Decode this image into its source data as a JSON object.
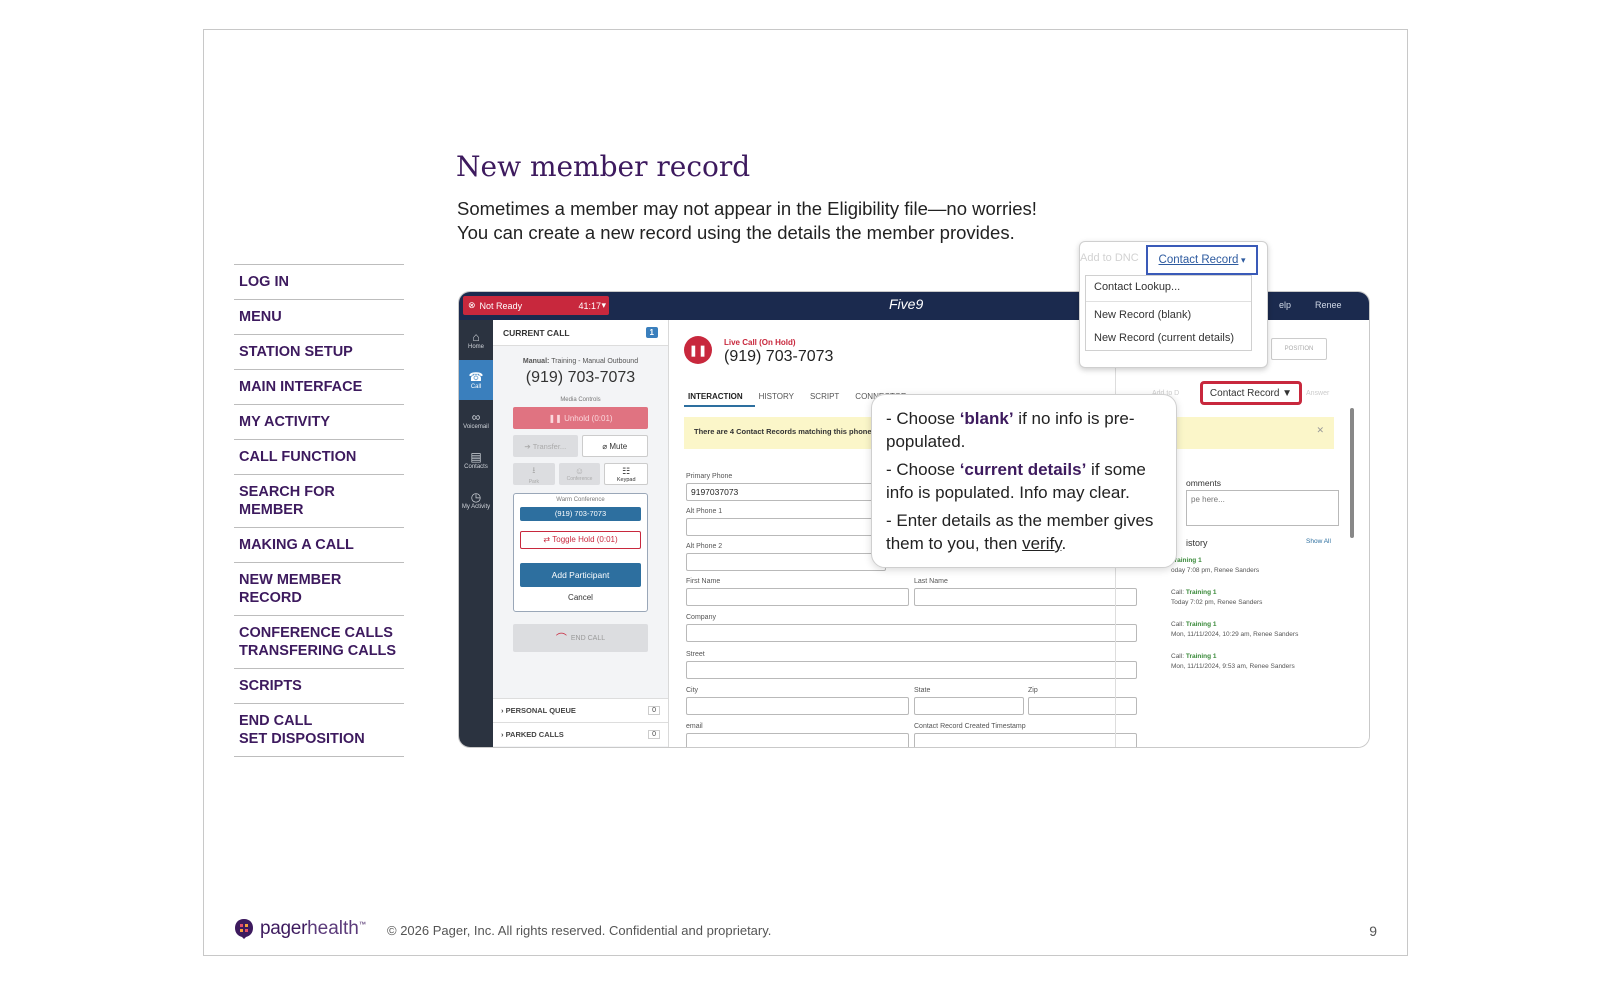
{
  "slide": {
    "title": "New member record",
    "subtitle_line1": "Sometimes a member may not appear in the Eligibility file—no worries!",
    "subtitle_line2": "You can create a new record using the details the member provides.",
    "page_number": "9",
    "copyright": "© 2026 Pager, Inc. All rights reserved. Confidential and proprietary.",
    "logo_text_1": "pager",
    "logo_text_2": "health",
    "logo_tm": "™"
  },
  "nav": {
    "items": [
      {
        "label": "LOG IN"
      },
      {
        "label": "MENU"
      },
      {
        "label": "STATION SETUP"
      },
      {
        "label": "MAIN INTERFACE"
      },
      {
        "label": "MY ACTIVITY"
      },
      {
        "label": "CALL FUNCTION"
      },
      {
        "label": "SEARCH FOR MEMBER"
      },
      {
        "label": "MAKING A CALL"
      },
      {
        "label": "NEW MEMBER RECORD"
      },
      {
        "label": "CONFERENCE CALLS",
        "label2": "TRANSFERING CALLS"
      },
      {
        "label": "SCRIPTS"
      },
      {
        "label": "END CALL",
        "label2": "SET DISPOSITION"
      }
    ]
  },
  "app": {
    "status": "Not Ready",
    "status_timer": "41:17",
    "brand": "Five9",
    "help": "elp",
    "user": "Renee",
    "rail": [
      {
        "label": "Home",
        "glyph": "⌂"
      },
      {
        "label": "Call",
        "glyph": "☎"
      },
      {
        "label": "Voicemail",
        "glyph": "∞"
      },
      {
        "label": "Contacts",
        "glyph": "▤"
      },
      {
        "label": "My Activity",
        "glyph": "◷"
      }
    ],
    "call_panel": {
      "header": "CURRENT CALL",
      "badge": "1",
      "manual_prefix": "Manual:",
      "manual_text": "Training - Manual Outbound",
      "number": "(919) 703-7073",
      "media_controls": "Media Controls",
      "unhold": "Unhold (0:01)",
      "transfer": "Transfer...",
      "mute": "Mute",
      "park": "Park",
      "conference": "Conference",
      "keypad": "Keypad",
      "warm_conference": "Warm Conference",
      "warm_number": "(919) 703-7073",
      "toggle_hold": "Toggle Hold (0:01)",
      "add_participant": "Add Participant",
      "cancel": "Cancel",
      "end_call": "END CALL",
      "personal_queue": "PERSONAL QUEUE",
      "personal_queue_count": "0",
      "parked_calls": "PARKED CALLS",
      "parked_calls_count": "0"
    },
    "main": {
      "live_label": "Live Call (On Hold)",
      "live_number": "(919) 703-7073",
      "tabs": [
        "INTERACTION",
        "HISTORY",
        "SCRIPT",
        "CONNECTOR"
      ],
      "banner": "There are 4 Contact Records matching this phone n",
      "fields": {
        "primary_phone_label": "Primary Phone",
        "primary_phone_value": "9197037073",
        "alt_phone_1_label": "Alt Phone 1",
        "alt_phone_2_label": "Alt Phone 2",
        "first_name_label": "First Name",
        "last_name_label": "Last Name",
        "company_label": "Company",
        "street_label": "Street",
        "city_label": "City",
        "state_label": "State",
        "zip_label": "Zip",
        "email_label": "email",
        "created_ts_label": "Contact Record Created Timestamp"
      },
      "right": {
        "disposition": "POSITION",
        "add_dnc": "Add to D",
        "contact_record": "Contact Record ▼",
        "answer": "Answer",
        "comments_label": "omments",
        "comments_placeholder": "pe here...",
        "history_label": "istory",
        "show_all": "Show All",
        "history": [
          {
            "prefix": "",
            "name": "Training 1",
            "meta": "oday 7:08 pm, Renee Sanders"
          },
          {
            "prefix": "Call:",
            "name": "Training 1",
            "meta": "Today 7:02 pm, Renee Sanders"
          },
          {
            "prefix": "Call:",
            "name": "Training 1",
            "meta": "Mon, 11/11/2024, 10:29 am, Renee Sanders"
          },
          {
            "prefix": "Call:",
            "name": "Training 1",
            "meta": "Mon, 11/11/2024, 9:53 am, Renee Sanders"
          }
        ]
      }
    }
  },
  "dropdown": {
    "add_dnc": "Add to DNC",
    "button": "Contact Record",
    "items": [
      "Contact Lookup...",
      "New Record (blank)",
      "New Record (current details)"
    ]
  },
  "callout": {
    "l1a": "- Choose ",
    "l1b": "‘blank’",
    "l1c": " if no info is pre-populated.",
    "l2a": "- Choose ",
    "l2b": "‘current details’",
    "l2c": " if some info is populated. Info may clear.",
    "l3a": "- Enter details as the member gives them to you, then ",
    "l3b": "verify",
    "l3c": "."
  }
}
